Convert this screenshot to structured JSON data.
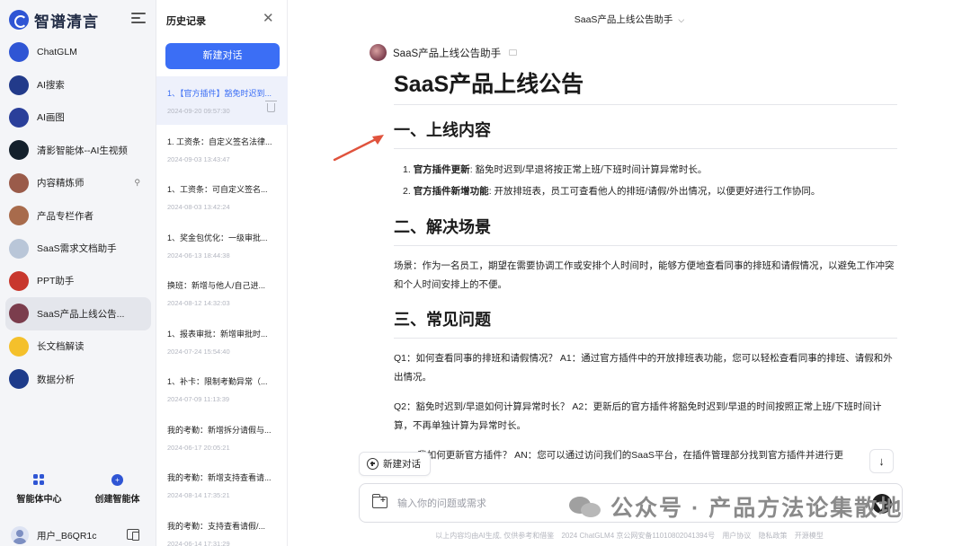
{
  "sidebar": {
    "brand": "智谱清言",
    "items": [
      {
        "label": "ChatGLM",
        "icon": "chatglm-icon",
        "color": "#2f55d4"
      },
      {
        "label": "AI搜索",
        "icon": "ai-search-icon",
        "color": "#223a8a"
      },
      {
        "label": "AI画图",
        "icon": "ai-drawing-icon",
        "color": "#2a3f9a"
      },
      {
        "label": "清影智能体--AI生视频",
        "icon": "video-agent-icon",
        "color": "#14202c"
      },
      {
        "label": "内容精炼师",
        "icon": "content-refiner-icon",
        "color": "#9a5b4a"
      },
      {
        "label": "产品专栏作者",
        "icon": "product-author-icon",
        "color": "#a86b4c"
      },
      {
        "label": "SaaS需求文档助手",
        "icon": "saas-doc-icon",
        "color": "#b9c6d8"
      },
      {
        "label": "PPT助手",
        "icon": "ppt-icon",
        "color": "#c8372d"
      },
      {
        "label": "SaaS产品上线公告...",
        "icon": "saas-announce-icon",
        "color": "#7b3d4d"
      },
      {
        "label": "长文档解读",
        "icon": "long-doc-icon",
        "color": "#f4c02b"
      },
      {
        "label": "数据分析",
        "icon": "data-analysis-icon",
        "color": "#1d3b8a"
      }
    ],
    "tools": {
      "agent_center": "智能体中心",
      "create_agent": "创建智能体"
    },
    "user": "用户_B6QR1c"
  },
  "history": {
    "title": "历史记录",
    "new_chat": "新建对话",
    "items": [
      {
        "title": "1、【官方插件】豁免时迟到...",
        "date": "2024-09-20 09:57:30"
      },
      {
        "title": "1. 工资条：自定义签名法律...",
        "date": "2024-09-03 13:43:47"
      },
      {
        "title": "1、工资条：可自定义签名...",
        "date": "2024-08-03 13:42:24"
      },
      {
        "title": "1、奖金包优化：一级审批...",
        "date": "2024-06-13 18:44:38"
      },
      {
        "title": "换班：新增与他人/自己进...",
        "date": "2024-08-12 14:32:03"
      },
      {
        "title": "1、报表审批：新增审批时...",
        "date": "2024-07-24 15:54:40"
      },
      {
        "title": "1、补卡：限制考勤异常（...",
        "date": "2024-07-09 11:13:39"
      },
      {
        "title": "我的考勤：新增拆分请假与...",
        "date": "2024-06-17 20:05:21"
      },
      {
        "title": "我的考勤：新增支持查看请...",
        "date": "2024-08-14 17:35:21"
      },
      {
        "title": "我的考勤：支持查看请假/...",
        "date": "2024-06-14 17:31:29"
      }
    ]
  },
  "main": {
    "top_title": "SaaS产品上线公告助手",
    "agent_name": "SaaS产品上线公告助手",
    "doc_title": "SaaS产品上线公告",
    "s1_heading": "一、上线内容",
    "s1_items": [
      {
        "num": "1.",
        "bold": "官方插件更新",
        "text": ": 豁免时迟到/早退将按正常上班/下班时间计算异常时长。"
      },
      {
        "num": "2.",
        "bold": "官方插件新增功能",
        "text": ": 开放排班表，员工可查看他人的排班/请假/外出情况，以便更好进行工作协同。"
      }
    ],
    "s2_heading": "二、解决场景",
    "s2_text": "场景：作为一名员工，期望在需要协调工作或安排个人时间时，能够方便地查看同事的排班和请假情况，以避免工作冲突和个人时间安排上的不便。",
    "s3_heading": "三、常见问题",
    "s3_q1": "Q1：如何查看同事的排班和请假情况？ A1：通过官方插件中的开放排班表功能，您可以轻松查看同事的排班、请假和外出情况。",
    "s3_q2": "Q2：豁免时迟到/早退如何计算异常时长？ A2：更新后的官方插件将豁免时迟到/早退的时间按照正常上班/下班时间计算，不再单独计算为异常时长。",
    "s3_qn": "QN：我如何更新官方插件？ AN：您可以通过访问我们的SaaS平台，在插件管理部分找到官方插件并进行更",
    "new_conversation": "新建对话",
    "input_placeholder": "输入你的问题或需求",
    "watermark": "公众号 · 产品方法论集散地",
    "footer": {
      "notice": "以上内容均由AI生成, 仅供参考和借鉴",
      "icp": "2024 ChatGLM4 京公网安备11010802041394号",
      "agreement": "用户协议",
      "privacy": "隐私政策",
      "opensource": "开源模型"
    }
  }
}
